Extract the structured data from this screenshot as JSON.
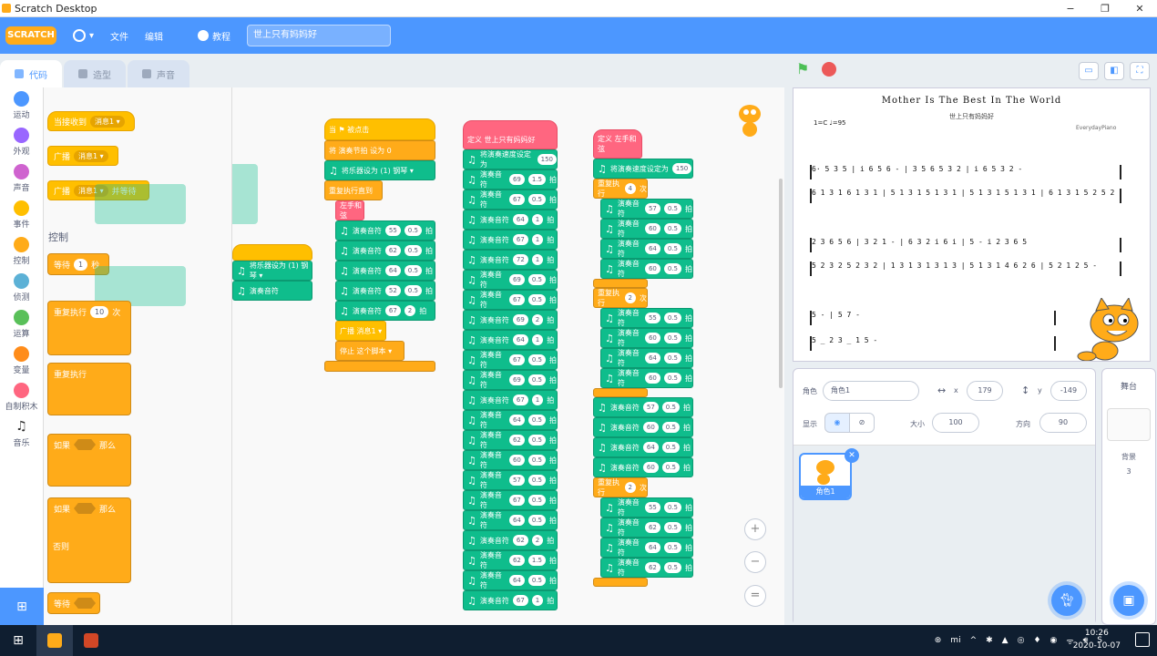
{
  "window": {
    "title": "Scratch Desktop",
    "buttons": [
      "−",
      "❐",
      "✕"
    ]
  },
  "menubar": {
    "logo": "SCRATCH",
    "file": "文件",
    "edit": "编辑",
    "tutorials": "教程",
    "project_title": "世上只有妈妈好"
  },
  "tabs": [
    {
      "label": "代码"
    },
    {
      "label": "造型"
    },
    {
      "label": "声音"
    }
  ],
  "categories": [
    {
      "label": "运动",
      "color": "#4c97ff"
    },
    {
      "label": "外观",
      "color": "#9966ff"
    },
    {
      "label": "声音",
      "color": "#cf63cf"
    },
    {
      "label": "事件",
      "color": "#ffbf00"
    },
    {
      "label": "控制",
      "color": "#ffab19"
    },
    {
      "label": "侦测",
      "color": "#5cb1d6"
    },
    {
      "label": "运算",
      "color": "#59c059"
    },
    {
      "label": "变量",
      "color": "#ff8c1a"
    },
    {
      "label": "自制积木",
      "color": "#ff6680"
    },
    {
      "label": "音乐",
      "color": "#0fbd8c"
    }
  ],
  "palette": {
    "when_receive": "当接收到",
    "message1": "消息1 ▾",
    "broadcast": "广播",
    "broadcast_wait": "并等待",
    "control_label": "控制",
    "wait": "等待",
    "wait_val": "1",
    "wait_unit": "秒",
    "repeat": "重复执行",
    "repeat_val": "10",
    "repeat_unit": "次",
    "forever": "重复执行",
    "if": "如果",
    "then": "那么",
    "else": "否则",
    "wait_until": "等待"
  },
  "scripts": {
    "col1": {
      "hat": "当 ⚑ 被点击",
      "set_var": "将 演奏节拍 设为 0",
      "set_instrument": "将乐器设为 (1) 钢琴 ▾",
      "repeat_until": "重复执行直到",
      "call": "左手和弦",
      "notes": [
        [
          "55",
          "0.5"
        ],
        [
          "62",
          "0.5"
        ],
        [
          "64",
          "0.5"
        ],
        [
          "52",
          "0.5"
        ],
        [
          "67",
          "2"
        ]
      ],
      "broadcast": "广播 消息1 ▾",
      "stop": "停止 这个脚本 ▾"
    },
    "col2": {
      "hat": "定义 世上只有妈妈好",
      "tempo": "将演奏速度设定为",
      "tempo_val": "150",
      "notes": [
        [
          "69",
          "1.5"
        ],
        [
          "67",
          "0.5"
        ],
        [
          "64",
          "1"
        ],
        [
          "67",
          "1"
        ],
        [
          "72",
          "1"
        ],
        [
          "69",
          "0.5"
        ],
        [
          "67",
          "0.5"
        ],
        [
          "69",
          "2"
        ],
        [
          "64",
          "1"
        ],
        [
          "67",
          "0.5"
        ],
        [
          "69",
          "0.5"
        ],
        [
          "67",
          "1"
        ],
        [
          "64",
          "0.5"
        ],
        [
          "62",
          "0.5"
        ],
        [
          "60",
          "0.5"
        ],
        [
          "57",
          "0.5"
        ],
        [
          "67",
          "0.5"
        ],
        [
          "64",
          "0.5"
        ],
        [
          "62",
          "2"
        ],
        [
          "62",
          "1.5"
        ],
        [
          "64",
          "0.5"
        ],
        [
          "67",
          "1"
        ]
      ]
    },
    "col3": {
      "hat": "定义 左手和弦",
      "tempo_val": "150",
      "repeat_a": "4",
      "group_a": [
        [
          "57",
          "0.5"
        ],
        [
          "60",
          "0.5"
        ],
        [
          "64",
          "0.5"
        ],
        [
          "60",
          "0.5"
        ]
      ],
      "repeat_b": "2",
      "group_b": [
        [
          "55",
          "0.5"
        ],
        [
          "60",
          "0.5"
        ],
        [
          "64",
          "0.5"
        ],
        [
          "60",
          "0.5"
        ]
      ],
      "group_c": [
        [
          "57",
          "0.5"
        ],
        [
          "60",
          "0.5"
        ],
        [
          "64",
          "0.5"
        ],
        [
          "60",
          "0.5"
        ]
      ],
      "group_d": [
        [
          "55",
          "0.5"
        ],
        [
          "62",
          "0.5"
        ],
        [
          "64",
          "0.5"
        ],
        [
          "62",
          "0.5"
        ]
      ],
      "play_note": "演奏音符",
      "beats": "拍",
      "repeat_word": "重复执行",
      "times": "次"
    }
  },
  "stage": {
    "sheet_title": "Mother Is The Best In The World",
    "sheet_sub": "世上只有妈妈好",
    "key": "1=C ♩=95",
    "credit": "EverydayPiano",
    "lines": [
      "6·  5 3 5 | i 6 5 6 - | 3 5 6 5 3 2 | i 6 5 3 2 -",
      "6 1 3 1 6 1 3 1 | 5 1 3 1 5 1 3 1 | 5 1 3 1 5 1 3 1 | 6 1 3 1 5 2 5 2",
      "2   3 6 5 6 | 3 2 1 - | 6   3 2 i 6 i | 5 - i 2 3 6 5",
      "5 2 3 2 5 2 3 2 | 1 3 1 3 1 3 1 3 | 5 1 3 1 4 6 2 6 | 5 2 1 2 5 - ",
      "5         -          | 5 7 -",
      "5 _ 2   3 _ 1   5      -"
    ]
  },
  "sprite": {
    "label_sprite": "角色",
    "name": "角色1",
    "x_label": "x",
    "x": "179",
    "y_label": "y",
    "y": "-149",
    "show_label": "显示",
    "size_label": "大小",
    "size": "100",
    "dir_label": "方向",
    "dir": "90",
    "thumb_name": "角色1"
  },
  "stage_panel": {
    "title": "舞台",
    "backdrop_label": "背景",
    "backdrop_count": "3"
  },
  "taskbar": {
    "time": "10:26",
    "date": "2020-10-07",
    "tray": [
      "⊛",
      "mi",
      "^",
      "✱",
      "▲",
      "◎",
      "♦",
      "◉",
      "ᯤ",
      "🔊︎",
      "S"
    ]
  }
}
